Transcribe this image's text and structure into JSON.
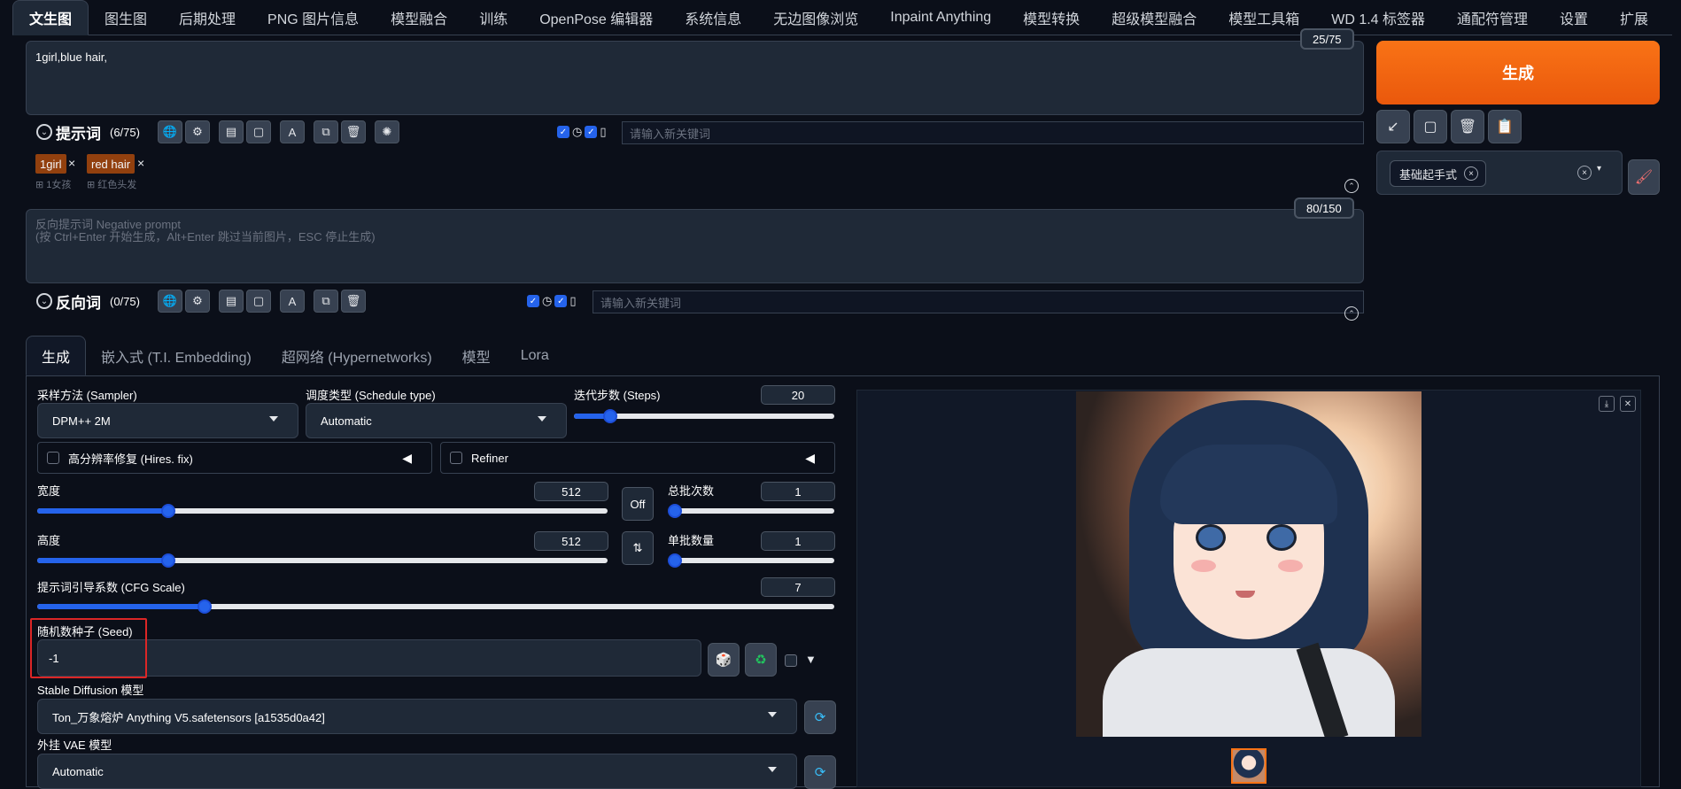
{
  "topnav": {
    "tabs": [
      "文生图",
      "图生图",
      "后期处理",
      "PNG 图片信息",
      "模型融合",
      "训练",
      "OpenPose 编辑器",
      "系统信息",
      "无边图像浏览",
      "Inpaint Anything",
      "模型转换",
      "超级模型融合",
      "模型工具箱",
      "WD 1.4 标签器",
      "通配符管理",
      "设置",
      "扩展"
    ]
  },
  "prompt": {
    "text": "1girl,blue hair,",
    "counter": "25/75",
    "label": "提示词",
    "count": "(6/75)",
    "keyword_placeholder": "请输入新关键词",
    "tags": [
      {
        "text": "1girl",
        "sub": "1女孩"
      },
      {
        "text": "red hair",
        "sub": "红色头发"
      }
    ]
  },
  "negative": {
    "placeholder_line1": "反向提示词 Negative prompt",
    "placeholder_line2": "(按 Ctrl+Enter 开始生成，Alt+Enter 跳过当前图片，ESC 停止生成)",
    "counter": "80/150",
    "label": "反向词",
    "count": "(0/75)",
    "keyword_placeholder": "请输入新关键词"
  },
  "right": {
    "generate_label": "生成",
    "style_chip": "基础起手式"
  },
  "lower_tabs": [
    "生成",
    "嵌入式 (T.I. Embedding)",
    "超网络 (Hypernetworks)",
    "模型",
    "Lora"
  ],
  "params": {
    "sampler_label": "采样方法 (Sampler)",
    "sampler_value": "DPM++ 2M",
    "schedule_label": "调度类型 (Schedule type)",
    "schedule_value": "Automatic",
    "steps_label": "迭代步数 (Steps)",
    "steps_value": "20",
    "steps_fraction": 0.14,
    "hires_label": "高分辨率修复 (Hires. fix)",
    "refiner_label": "Refiner",
    "width_label": "宽度",
    "width_value": "512",
    "width_fraction": 0.23,
    "height_label": "高度",
    "height_value": "512",
    "height_fraction": 0.23,
    "off_label": "Off",
    "batch_count_label": "总批次数",
    "batch_count_value": "1",
    "batch_size_label": "单批数量",
    "batch_size_value": "1",
    "cfg_label": "提示词引导系数 (CFG Scale)",
    "cfg_value": "7",
    "cfg_fraction": 0.21,
    "seed_label": "随机数种子 (Seed)",
    "seed_value": "-1",
    "sd_model_label": "Stable Diffusion 模型",
    "sd_model_value": "Ton_万象熔炉 Anything V5.safetensors [a1535d0a42]",
    "vae_label": "外挂 VAE 模型",
    "vae_value": "Automatic"
  },
  "colors": {
    "accent": "#2563eb",
    "generate": "#f97316",
    "highlight": "#dc2626"
  }
}
